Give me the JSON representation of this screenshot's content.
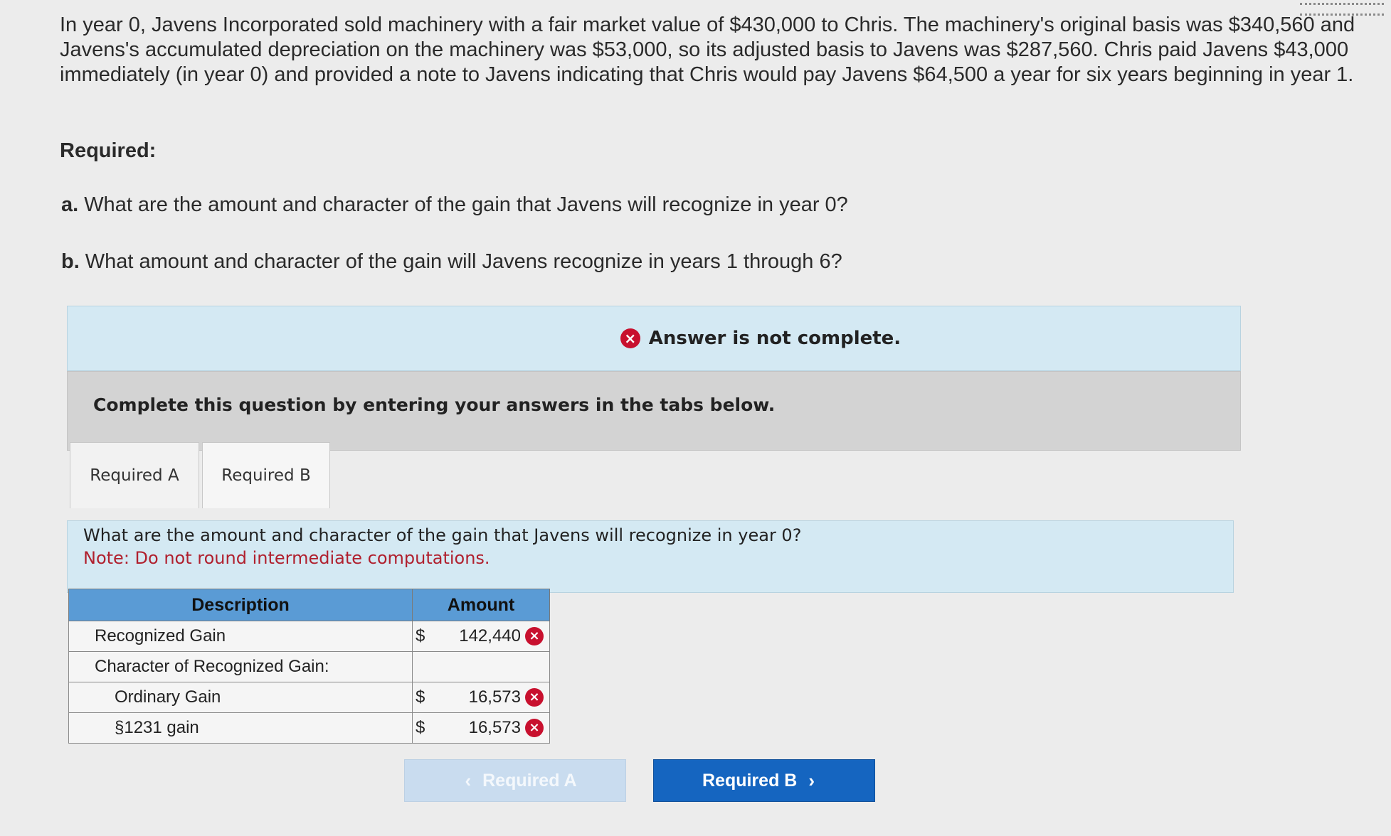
{
  "problem": {
    "text": "In year 0, Javens Incorporated sold machinery with a fair market value of $430,000 to Chris. The machinery's original basis was $340,560 and Javens's accumulated depreciation on the machinery was $53,000, so its adjusted basis to Javens was $287,560. Chris paid Javens $43,000 immediately (in year 0) and provided a note to Javens indicating that Chris would pay Javens $64,500 a year for six years beginning in year 1.",
    "required_heading": "Required:",
    "questions": [
      {
        "label": "a.",
        "text": "What are the amount and character of the gain that Javens will recognize in year 0?"
      },
      {
        "label": "b.",
        "text": "What amount and character of the gain will Javens recognize in years 1 through 6?"
      }
    ]
  },
  "status": {
    "text": "Answer is not complete.",
    "icon": "x-circle-icon",
    "icon_glyph": "×",
    "color": "#c8102e"
  },
  "instruction": "Complete this question by entering your answers in the tabs below.",
  "tabs": [
    {
      "label": "Required A",
      "active": true
    },
    {
      "label": "Required B",
      "active": false
    }
  ],
  "prompt": {
    "question": "What are the amount and character of the gain that Javens will recognize in year 0?",
    "note": "Note: Do not round intermediate computations."
  },
  "table": {
    "headers": [
      "Description",
      "Amount"
    ],
    "rows": [
      {
        "description": "Recognized Gain",
        "currency": "$",
        "amount": "142,440",
        "marked_wrong": true
      },
      {
        "description": "Character of Recognized Gain:",
        "currency": "",
        "amount": "",
        "marked_wrong": false
      },
      {
        "description": "Ordinary Gain",
        "currency": "$",
        "amount": "16,573",
        "marked_wrong": true
      },
      {
        "description": "§1231 gain",
        "currency": "$",
        "amount": "16,573",
        "marked_wrong": true
      }
    ]
  },
  "nav": {
    "prev_label": "Required A",
    "next_label": "Required B",
    "prev_glyph": "‹",
    "next_glyph": "›"
  },
  "colors": {
    "accent": "#1565c0",
    "table_header": "#5a9bd5",
    "banner": "#d4e9f3",
    "error": "#c8102e"
  }
}
